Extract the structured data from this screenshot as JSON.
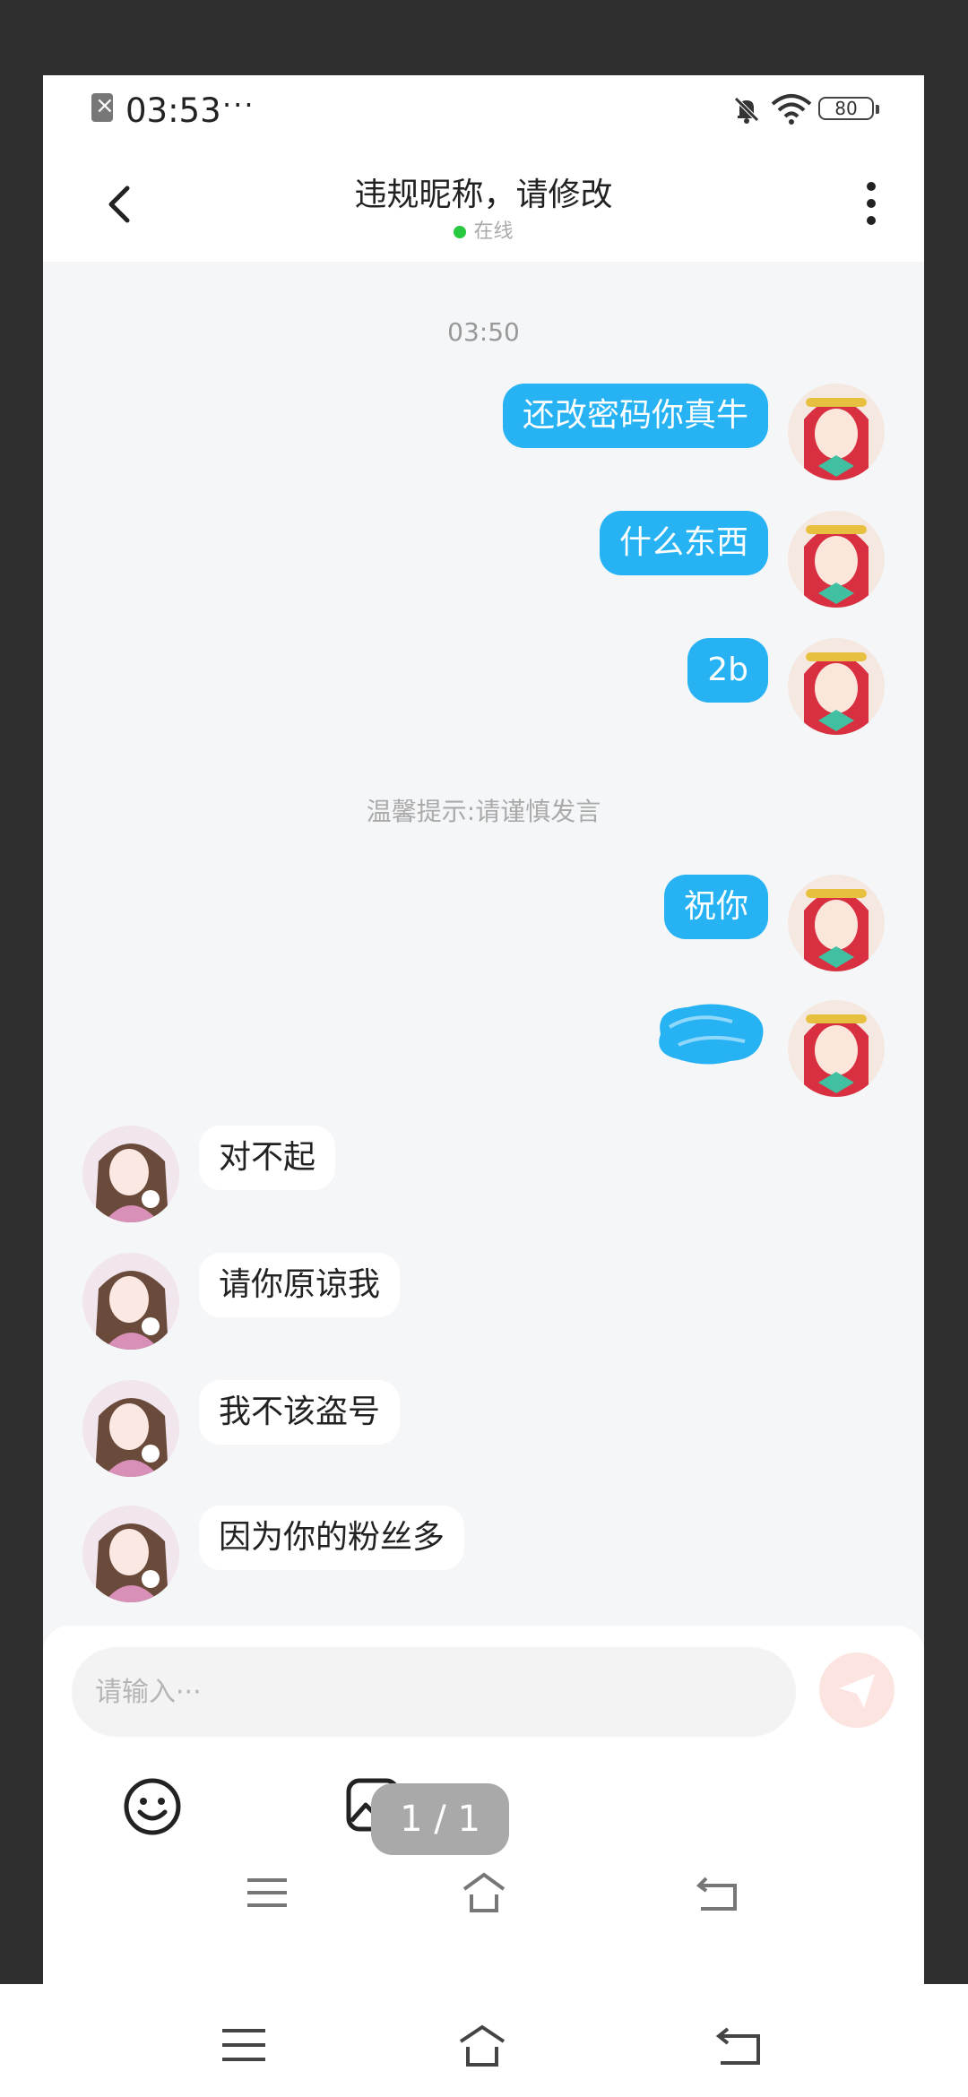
{
  "status_bar": {
    "time": "03:53",
    "dots": "···",
    "battery": "80"
  },
  "header": {
    "title": "违规昵称，请修改",
    "status": "在线"
  },
  "chat": {
    "time": "03:50",
    "tip": "温馨提示:请谨慎发言",
    "sent": [
      "还改密码你真牛",
      "什么东西",
      "2b",
      "祝你"
    ],
    "received": [
      "对不起",
      "请你原谅我",
      "我不该盗号",
      "因为你的粉丝多"
    ]
  },
  "input": {
    "placeholder": "请输入···"
  },
  "page_indicator": "1 / 1",
  "colors": {
    "accent": "#27b3f3",
    "online": "#28c840",
    "send": "#fce4e0"
  }
}
